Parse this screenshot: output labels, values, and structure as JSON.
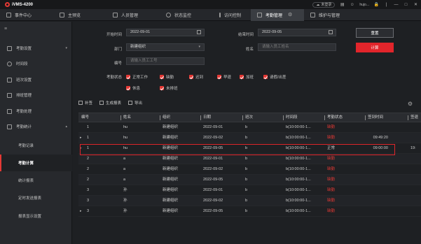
{
  "app": {
    "title": "iVMS-4200",
    "user_label": "未登录",
    "username": "hujo...",
    "win_controls": [
      "🔒",
      "|",
      "—",
      "□",
      "✕"
    ]
  },
  "nav": {
    "items": [
      {
        "label": "事件中心",
        "active": false
      },
      {
        "label": "主预览",
        "active": false
      },
      {
        "label": "人员管理",
        "active": false
      },
      {
        "label": "状态监控",
        "active": false
      },
      {
        "label": "访问控制",
        "active": false
      },
      {
        "label": "考勤管理",
        "active": true
      },
      {
        "label": "维护与管理",
        "active": false
      }
    ]
  },
  "sidebar": {
    "menu_icon": "≡",
    "items": [
      {
        "label": "考勤设置",
        "chevron": "▾"
      },
      {
        "label": "时间段",
        "chevron": ""
      },
      {
        "label": "班次设置",
        "chevron": ""
      },
      {
        "label": "排班管理",
        "chevron": ""
      },
      {
        "label": "考勤处理",
        "chevron": ""
      },
      {
        "label": "考勤统计",
        "chevron": "▴"
      }
    ],
    "subitems": [
      {
        "label": "考勤记录",
        "active": false
      },
      {
        "label": "考勤计算",
        "active": true
      },
      {
        "label": "统计报表",
        "active": false
      },
      {
        "label": "定时发送报表",
        "active": false
      },
      {
        "label": "报表显示设置",
        "active": false
      }
    ]
  },
  "filters": {
    "start_label": "开始时间",
    "start_value": "2022-09-01",
    "end_label": "结束时间",
    "end_value": "2022-09-05",
    "dept_label": "部门",
    "dept_value": "新建组织",
    "name_label": "姓名",
    "name_placeholder": "请输入员工姓名",
    "id_label": "编号",
    "id_placeholder": "请输入员工工号",
    "status_label": "考勤状态",
    "statuses": [
      "正常工作",
      "缺勤",
      "迟到",
      "早退",
      "加班",
      "请假/出差",
      "休息",
      "未排班"
    ],
    "reset_label": "重置",
    "calc_label": "计算"
  },
  "toolbar": {
    "items": [
      "补签",
      "生成报表",
      "导出"
    ]
  },
  "table": {
    "columns": [
      "编号",
      "姓名",
      "组织",
      "日期",
      "班次",
      "时间段",
      "考勤状态",
      "签到时间",
      "签退"
    ],
    "rows": [
      {
        "id": "1",
        "name": "hu",
        "org": "新建组织",
        "date": "2022-09-01",
        "shift": "b",
        "period": "b(10:00:00-1...",
        "status": "缺勤",
        "status_red": true,
        "checkin": "",
        "checkout": "",
        "expand": ""
      },
      {
        "id": "1",
        "name": "hu",
        "org": "新建组织",
        "date": "2022-09-02",
        "shift": "b",
        "period": "b(10:00:00-1...",
        "status": "缺勤",
        "status_red": true,
        "checkin": "09:49:20",
        "checkout": "",
        "expand": "▸"
      },
      {
        "id": "1",
        "name": "hu",
        "org": "新建组织",
        "date": "2022-09-05",
        "shift": "b",
        "period": "b(10:00:00-1...",
        "status": "正常",
        "status_red": false,
        "checkin": "09:00:00",
        "checkout": "19:",
        "expand": "▸"
      },
      {
        "id": "2",
        "name": "a",
        "org": "新建组织",
        "date": "2022-09-01",
        "shift": "b",
        "period": "b(10:00:00-1...",
        "status": "缺勤",
        "status_red": true,
        "checkin": "",
        "checkout": "",
        "expand": ""
      },
      {
        "id": "2",
        "name": "a",
        "org": "新建组织",
        "date": "2022-09-02",
        "shift": "b",
        "period": "b(10:00:00-1...",
        "status": "缺勤",
        "status_red": true,
        "checkin": "",
        "checkout": "",
        "expand": ""
      },
      {
        "id": "2",
        "name": "a",
        "org": "新建组织",
        "date": "2022-09-05",
        "shift": "b",
        "period": "b(10:00:00-1...",
        "status": "缺勤",
        "status_red": true,
        "checkin": "",
        "checkout": "",
        "expand": ""
      },
      {
        "id": "3",
        "name": "孙",
        "org": "新建组织",
        "date": "2022-09-01",
        "shift": "b",
        "period": "b(10:00:00-1...",
        "status": "缺勤",
        "status_red": true,
        "checkin": "",
        "checkout": "",
        "expand": ""
      },
      {
        "id": "3",
        "name": "孙",
        "org": "新建组织",
        "date": "2022-09-02",
        "shift": "b",
        "period": "b(10:00:00-1...",
        "status": "缺勤",
        "status_red": true,
        "checkin": "",
        "checkout": "",
        "expand": ""
      },
      {
        "id": "3",
        "name": "孙",
        "org": "新建组织",
        "date": "2022-09-05",
        "shift": "b",
        "period": "b(10:00:00-1...",
        "status": "缺勤",
        "status_red": true,
        "checkin": "",
        "checkout": "",
        "expand": "▸"
      }
    ]
  },
  "colors": {
    "accent": "#e53935",
    "highlight_box": "#e0262b",
    "background": "#1e2023"
  }
}
